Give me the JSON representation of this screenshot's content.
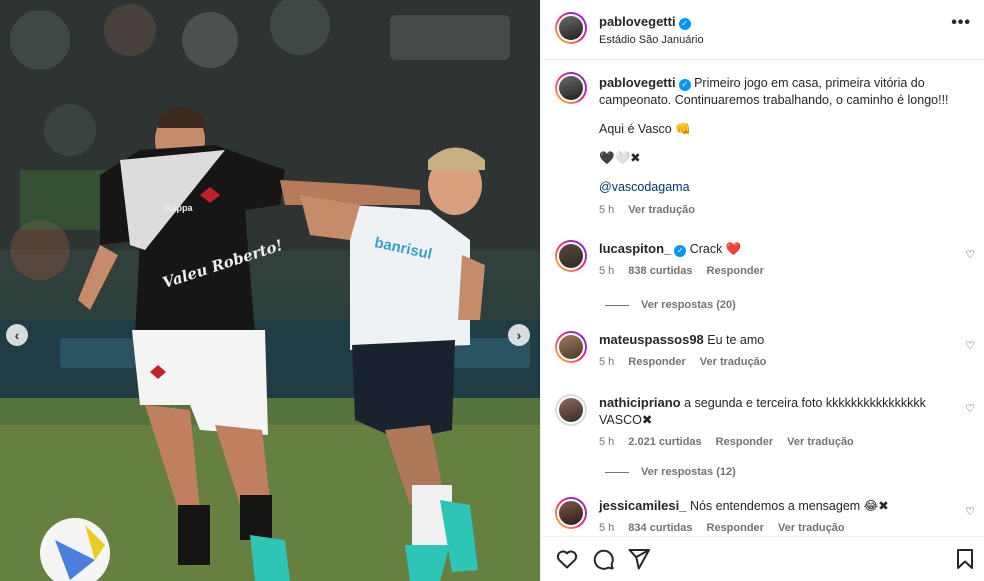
{
  "post": {
    "author": "pablovegetti",
    "location": "Estádio São Januário",
    "caption_line1": "Primeiro jogo em casa, primeira vitória do campeonato. Continuaremos trabalhando, o caminho é longo!!!",
    "caption_line2": "Aqui é Vasco 👊",
    "caption_emoji": "🖤🤍✖",
    "mention": "@vascodagama",
    "time": "5 h",
    "translate": "Ver tradução",
    "photo_text": {
      "jersey_text": "Valeu Roberto!",
      "sponsor": "banrisul",
      "kit_brand": "Kappa"
    }
  },
  "comments": [
    {
      "user": "lucaspiton_",
      "verified": true,
      "text": "Crack ❤️",
      "time": "5 h",
      "likes": "838 curtidas",
      "reply": "Responder",
      "replies": "Ver respostas (20)"
    },
    {
      "user": "mateuspassos98",
      "verified": false,
      "text": "Eu te amo",
      "time": "5 h",
      "reply": "Responder",
      "translate": "Ver tradução"
    },
    {
      "user": "nathicipriano",
      "verified": false,
      "text": "a segunda e terceira foto kkkkkkkkkkkkkkkk VASCO✖",
      "time": "5 h",
      "likes": "2.021 curtidas",
      "reply": "Responder",
      "translate": "Ver tradução",
      "replies": "Ver respostas (12)"
    },
    {
      "user": "jessicamilesi_",
      "verified": false,
      "text": "Nós entendemos a mensagem 😂✖",
      "time": "5 h",
      "likes": "834 curtidas",
      "reply": "Responder",
      "translate": "Ver tradução"
    }
  ],
  "icons": [
    "heart-icon",
    "comment-icon",
    "share-icon",
    "bookmark-icon",
    "more-icon",
    "verified-icon"
  ],
  "colors": {
    "verified": "#0095f6",
    "text": "#262626",
    "muted": "#737373",
    "link": "#00376b"
  }
}
